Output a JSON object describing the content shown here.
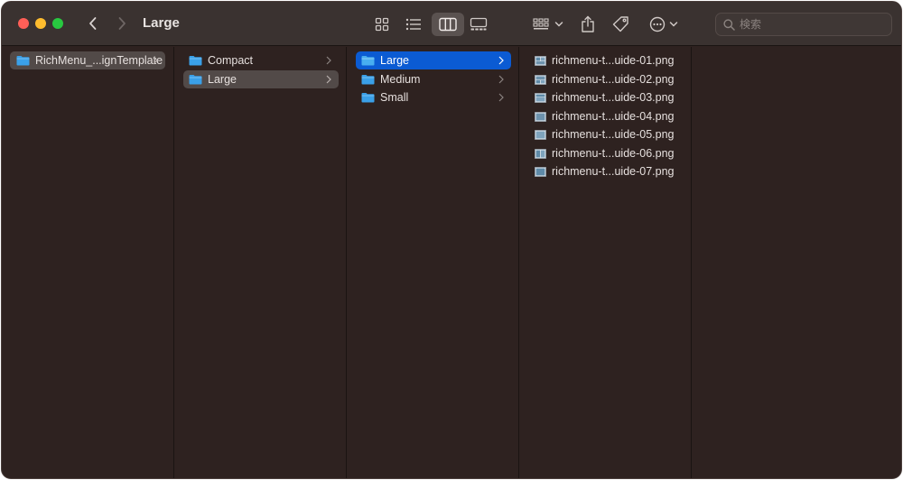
{
  "window": {
    "title": "Large"
  },
  "toolbar": {
    "search_placeholder": "検索"
  },
  "colors": {
    "selection_active": "#0b5bd3",
    "selection_inactive": "#524a48",
    "folder": "#3aa0e8",
    "background": "#2e2220"
  },
  "columns": [
    {
      "items": [
        {
          "label": "RichMenu_...ignTemplate",
          "type": "folder",
          "selected": "inactive"
        }
      ]
    },
    {
      "items": [
        {
          "label": "Compact",
          "type": "folder"
        },
        {
          "label": "Large",
          "type": "folder",
          "selected": "inactive"
        }
      ]
    },
    {
      "items": [
        {
          "label": "Large",
          "type": "folder",
          "selected": "active"
        },
        {
          "label": "Medium",
          "type": "folder"
        },
        {
          "label": "Small",
          "type": "folder"
        }
      ]
    },
    {
      "items": [
        {
          "label": "richmenu-t...uide-01.png",
          "type": "png-icon"
        },
        {
          "label": "richmenu-t...uide-02.png",
          "type": "png-icon"
        },
        {
          "label": "richmenu-t...uide-03.png",
          "type": "png-icon"
        },
        {
          "label": "richmenu-t...uide-04.png",
          "type": "png-icon"
        },
        {
          "label": "richmenu-t...uide-05.png",
          "type": "png-icon"
        },
        {
          "label": "richmenu-t...uide-06.png",
          "type": "png-icon"
        },
        {
          "label": "richmenu-t...uide-07.png",
          "type": "png-icon"
        }
      ]
    }
  ]
}
